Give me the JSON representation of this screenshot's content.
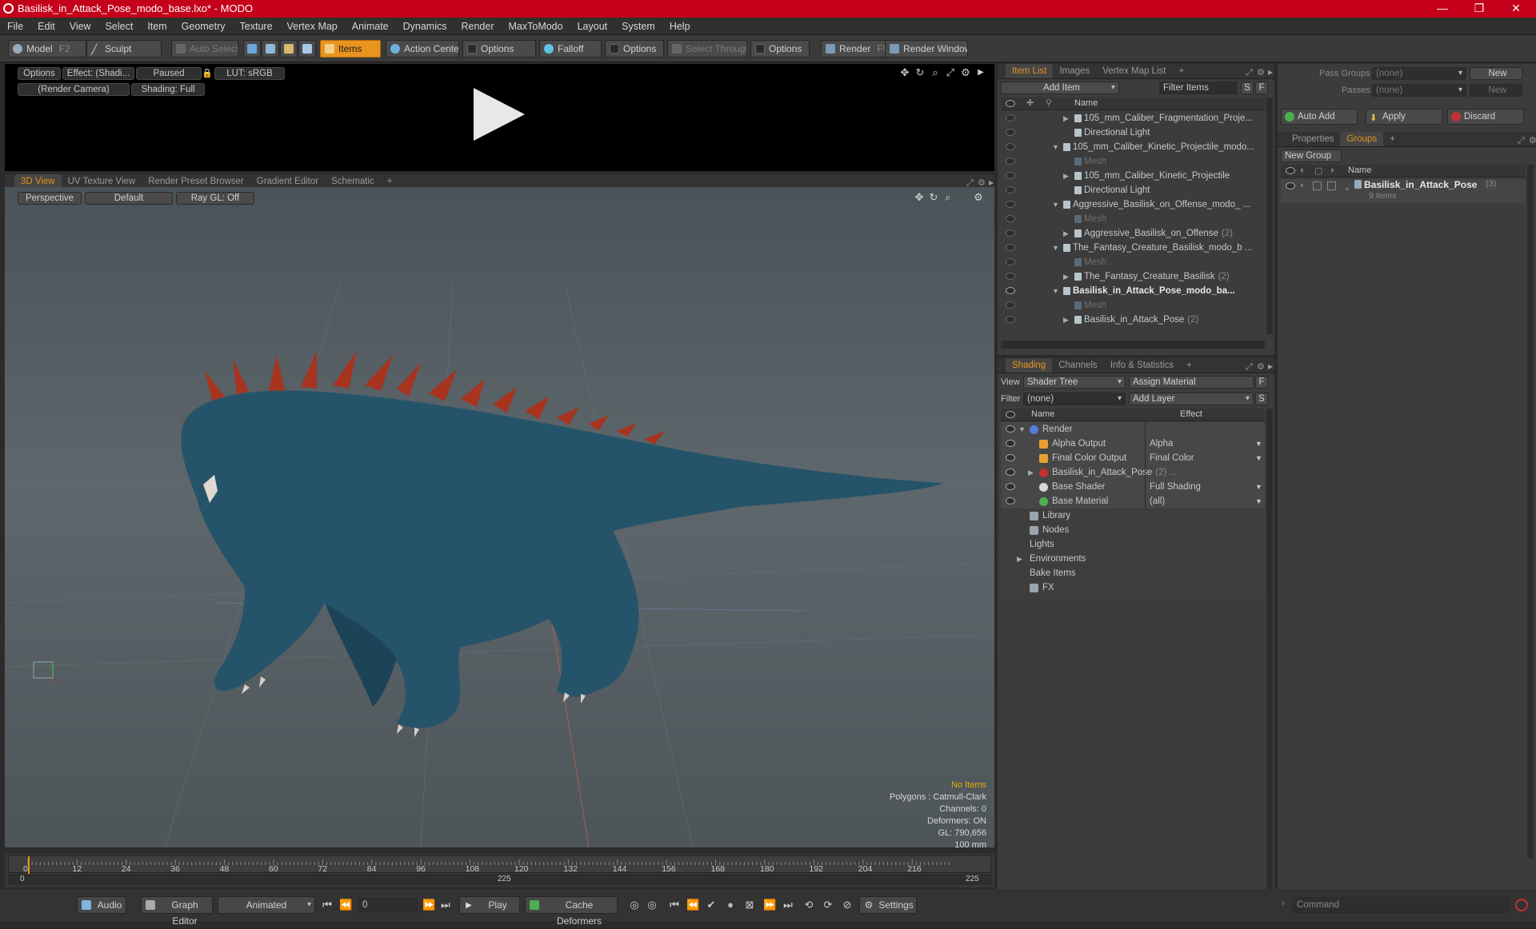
{
  "window": {
    "title": "Basilisk_in_Attack_Pose_modo_base.lxo* - MODO",
    "minimize": "—",
    "maximize": "❐",
    "close": "✕"
  },
  "menu": [
    "File",
    "Edit",
    "View",
    "Select",
    "Item",
    "Geometry",
    "Texture",
    "Vertex Map",
    "Animate",
    "Dynamics",
    "Render",
    "MaxToModo",
    "Layout",
    "System",
    "Help"
  ],
  "toolbar": {
    "model": "Model",
    "model_key": "F2",
    "sculpt": "Sculpt",
    "auto_select": "Auto Select",
    "items": "Items",
    "action_center": "Action Center",
    "options1": "Options",
    "falloff": "Falloff",
    "options2": "Options",
    "select_through": "Select Through",
    "options3": "Options",
    "render": "Render",
    "render_key": "F9",
    "render_window": "Render Window"
  },
  "preview": {
    "options": "Options",
    "effect": "Effect: (Shadi...",
    "paused": "Paused",
    "lut": "LUT: sRGB",
    "camera": "(Render Camera)",
    "shading": "Shading: Full"
  },
  "viewport_tabs": [
    "3D View",
    "UV Texture View",
    "Render Preset Browser",
    "Gradient Editor",
    "Schematic"
  ],
  "viewport": {
    "perspective": "Perspective",
    "default": "Default",
    "raygl": "Ray GL: Off",
    "hud": {
      "no_items": "No Items",
      "polygons": "Polygons : Catmull-Clark",
      "channels": "Channels: 0",
      "deformers": "Deformers: ON",
      "gl": "GL: 790,656",
      "scale": "100 mm"
    }
  },
  "timeline": {
    "ticks": [
      "0",
      "12",
      "24",
      "36",
      "48",
      "60",
      "72",
      "84",
      "96",
      "108",
      "120",
      "132",
      "144",
      "156",
      "168",
      "180",
      "192",
      "204",
      "216"
    ],
    "start": "0",
    "mid": "225",
    "end": "225"
  },
  "bottom": {
    "audio": "Audio",
    "graph_editor": "Graph Editor",
    "animated": "Animated",
    "frame": "0",
    "play": "Play",
    "cache": "Cache Deformers",
    "settings": "Settings"
  },
  "item_list": {
    "tabs": [
      "Item List",
      "Images",
      "Vertex Map List"
    ],
    "add_item": "Add Item",
    "filter_items": "Filter Items",
    "s": "S",
    "f": "F",
    "col_name": "Name",
    "rows": [
      {
        "label": "105_mm_Caliber_Fragmentation_Proje...",
        "indent": 2,
        "tri": "▶",
        "style": ""
      },
      {
        "label": "Directional Light",
        "indent": 2,
        "tri": "",
        "style": ""
      },
      {
        "label": "105_mm_Caliber_Kinetic_Projectile_modo...",
        "indent": 1,
        "tri": "▼",
        "style": ""
      },
      {
        "label": "Mesh",
        "indent": 2,
        "tri": "",
        "style": "mesh"
      },
      {
        "label": "105_mm_Caliber_Kinetic_Projectile",
        "indent": 2,
        "tri": "▶",
        "style": ""
      },
      {
        "label": "Directional Light",
        "indent": 2,
        "tri": "",
        "style": ""
      },
      {
        "label": "Aggressive_Basilisk_on_Offense_modo_ ...",
        "indent": 1,
        "tri": "▼",
        "style": ""
      },
      {
        "label": "Mesh",
        "indent": 2,
        "tri": "",
        "style": "mesh"
      },
      {
        "label": "Aggressive_Basilisk_on_Offense",
        "count": "(2)",
        "indent": 2,
        "tri": "▶",
        "style": ""
      },
      {
        "label": "The_Fantasy_Creature_Basilisk_modo_b ...",
        "indent": 1,
        "tri": "▼",
        "style": ""
      },
      {
        "label": "Mesh",
        "indent": 2,
        "tri": "",
        "style": "mesh"
      },
      {
        "label": "The_Fantasy_Creature_Basilisk",
        "count": "(2)",
        "indent": 2,
        "tri": "▶",
        "style": ""
      },
      {
        "label": "Basilisk_in_Attack_Pose_modo_ba...",
        "indent": 1,
        "tri": "▼",
        "style": "bold"
      },
      {
        "label": "Mesh",
        "indent": 2,
        "tri": "",
        "style": "mesh"
      },
      {
        "label": "Basilisk_in_Attack_Pose",
        "count": "(2)",
        "indent": 2,
        "tri": "▶",
        "style": ""
      }
    ]
  },
  "shading": {
    "tabs": [
      "Shading",
      "Channels",
      "Info & Statistics"
    ],
    "view_label": "View",
    "view_value": "Shader Tree",
    "assign": "Assign Material",
    "filter_label": "Filter",
    "filter_value": "(none)",
    "add_layer": "Add Layer",
    "f": "F",
    "s": "S",
    "col_name": "Name",
    "col_effect": "Effect",
    "rows": [
      {
        "label": "Render",
        "effect": "",
        "indent": 1,
        "tri": "▼",
        "eye": true
      },
      {
        "label": "Alpha Output",
        "effect": "Alpha",
        "indent": 2,
        "tri": "",
        "eye": true
      },
      {
        "label": "Final Color Output",
        "effect": "Final Color",
        "indent": 2,
        "tri": "",
        "eye": true
      },
      {
        "label": "Basilisk_in_Attack_Pose",
        "count": "(2) ...",
        "effect": "",
        "indent": 2,
        "tri": "▶",
        "eye": true
      },
      {
        "label": "Base Shader",
        "effect": "Full Shading",
        "indent": 2,
        "tri": "",
        "eye": true
      },
      {
        "label": "Base Material",
        "effect": "(all)",
        "indent": 2,
        "tri": "",
        "eye": true
      },
      {
        "label": "Library",
        "effect": "",
        "indent": 1,
        "tri": "",
        "eye": false
      },
      {
        "label": "Nodes",
        "effect": "",
        "indent": 1,
        "tri": "",
        "eye": false
      },
      {
        "label": "Lights",
        "effect": "",
        "indent": 0,
        "tri": "",
        "eye": false
      },
      {
        "label": "Environments",
        "effect": "",
        "indent": 0,
        "tri": "▶",
        "eye": false
      },
      {
        "label": "Bake Items",
        "effect": "",
        "indent": 0,
        "tri": "",
        "eye": false
      },
      {
        "label": "FX",
        "effect": "",
        "indent": 1,
        "tri": "",
        "eye": false
      }
    ]
  },
  "right": {
    "pass_groups": "Pass Groups",
    "passes": "Passes",
    "none1": "(none)",
    "none2": "(none)",
    "new1": "New",
    "new2": "New",
    "auto_add": "Auto Add",
    "apply": "Apply",
    "discard": "Discard",
    "tabs": [
      "Properties",
      "Groups"
    ],
    "new_group": "New Group",
    "col_name": "Name",
    "group_name": "Basilisk_in_Attack_Pose",
    "group_count": "(3)",
    "group_items": "9 Items",
    "command": "Command"
  }
}
